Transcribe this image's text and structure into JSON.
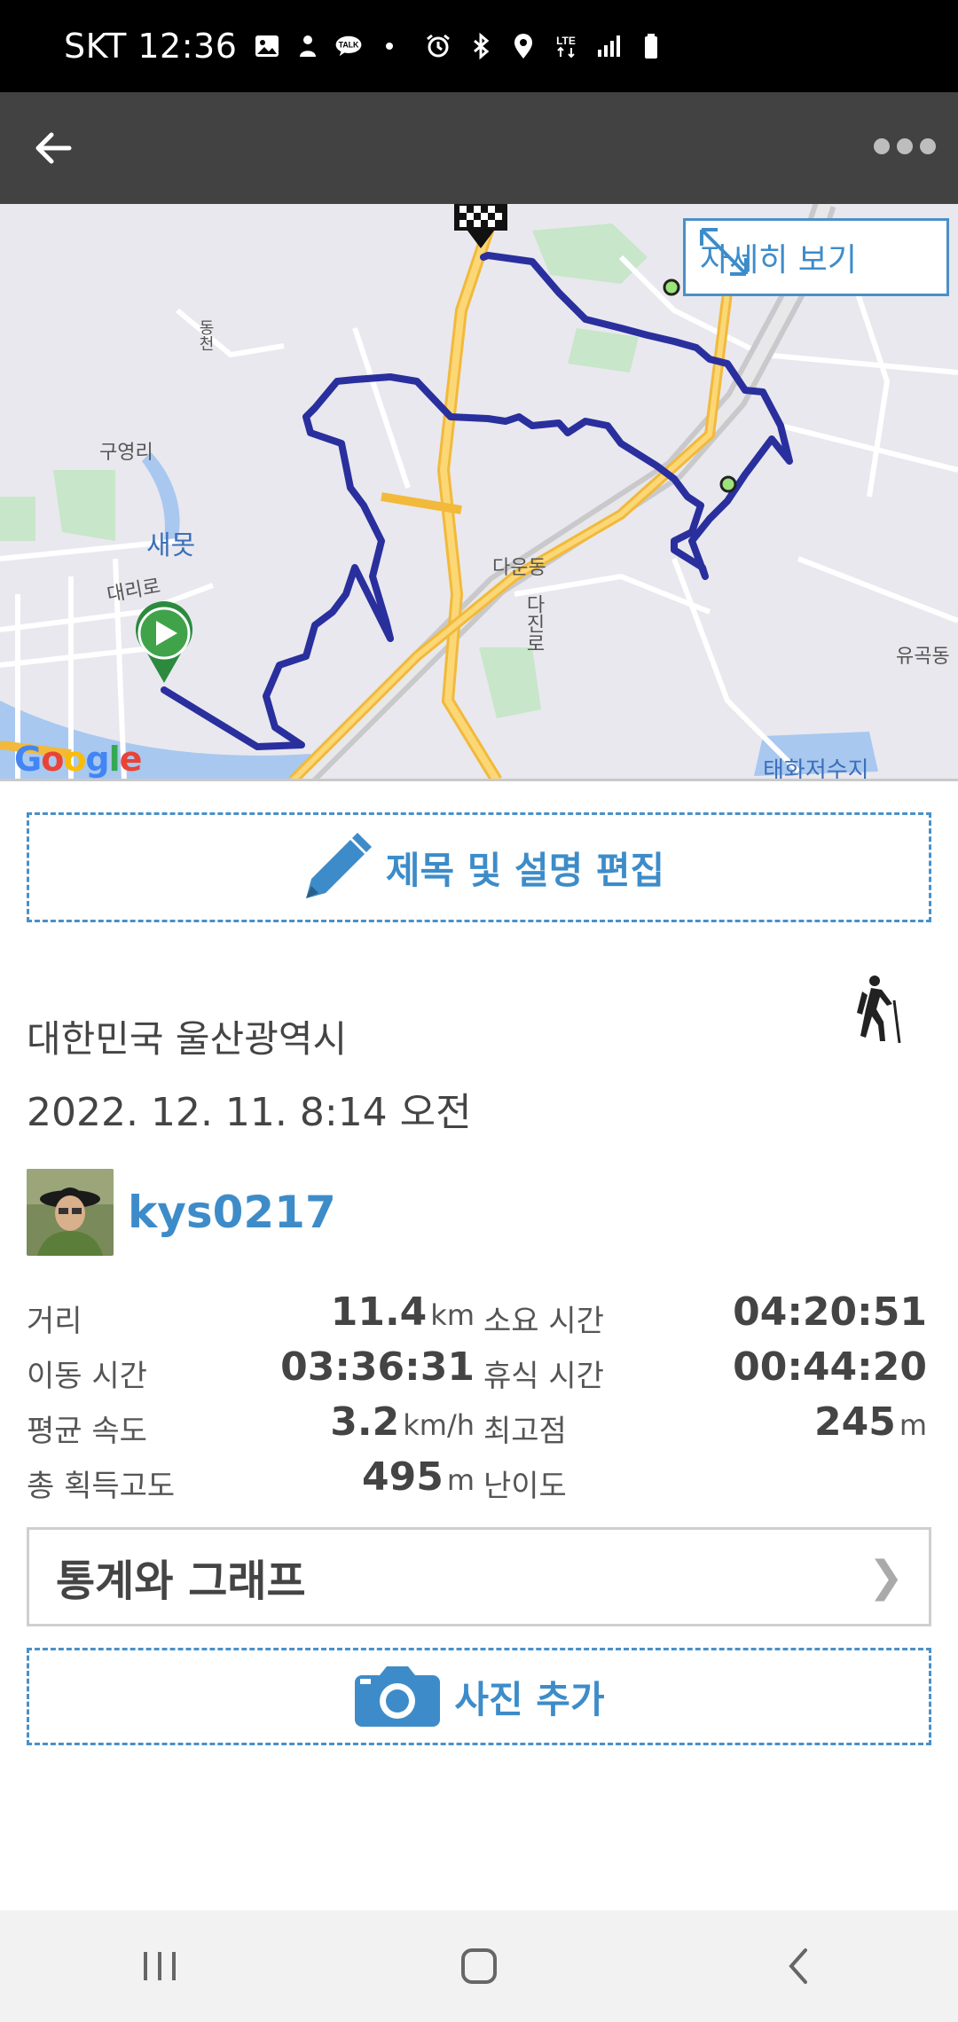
{
  "status_bar": {
    "carrier_time": "SKT 12:36",
    "left_icons": [
      "gallery-icon",
      "notification-icon",
      "kakaotalk-icon",
      "dot-icon"
    ],
    "right_icons": [
      "alarm-icon",
      "bluetooth-icon",
      "location-icon",
      "lte-icon",
      "signal-icon",
      "battery-icon"
    ]
  },
  "toolbar": {
    "back_icon": "arrow-left-icon",
    "more_icon": "more-dots-icon"
  },
  "map": {
    "detail_button_label": "자세히 보기",
    "labels": {
      "guyeongri": "구영리",
      "saemot": "새못",
      "daeriro": "대리로",
      "dawundong": "다운동",
      "dajinro": "다진로",
      "yugokdong": "유곡동",
      "taehwa": "태화저수지",
      "road_v": "동천"
    },
    "google_logo": "Google",
    "route_color": "#2a2f9e"
  },
  "edit_button": {
    "label": "제목 및 설명 편집",
    "icon": "pencil-icon"
  },
  "activity": {
    "location": "대한민국 울산광역시",
    "datetime": "2022. 12. 11. 8:14 오전",
    "type_icon": "hiking-icon"
  },
  "user": {
    "name": "kys0217"
  },
  "stats": {
    "distance": {
      "label": "거리",
      "value": "11.4",
      "unit": "km"
    },
    "total_time": {
      "label": "소요 시간",
      "value": "04:20:51"
    },
    "moving_time": {
      "label": "이동 시간",
      "value": "03:36:31"
    },
    "rest_time": {
      "label": "휴식 시간",
      "value": "00:44:20"
    },
    "avg_speed": {
      "label": "평균 속도",
      "value": "3.2",
      "unit": "km/h"
    },
    "max_altitude": {
      "label": "최고점",
      "value": "245",
      "unit": "m"
    },
    "total_ascent": {
      "label": "총 획득고도",
      "value": "495",
      "unit": "m"
    },
    "difficulty": {
      "label": "난이도",
      "value": ""
    }
  },
  "stats_graph_button": {
    "label": "통계와 그래프",
    "chevron": "❯"
  },
  "add_photo_button": {
    "label": "사진 추가",
    "icon": "camera-icon"
  },
  "nav": {
    "recent_icon": "recent-apps-icon",
    "home_icon": "home-icon",
    "back_icon": "nav-back-icon"
  },
  "colors": {
    "accent": "#3d8cc9",
    "toolbar": "#424242",
    "route": "#2a2f9e"
  }
}
